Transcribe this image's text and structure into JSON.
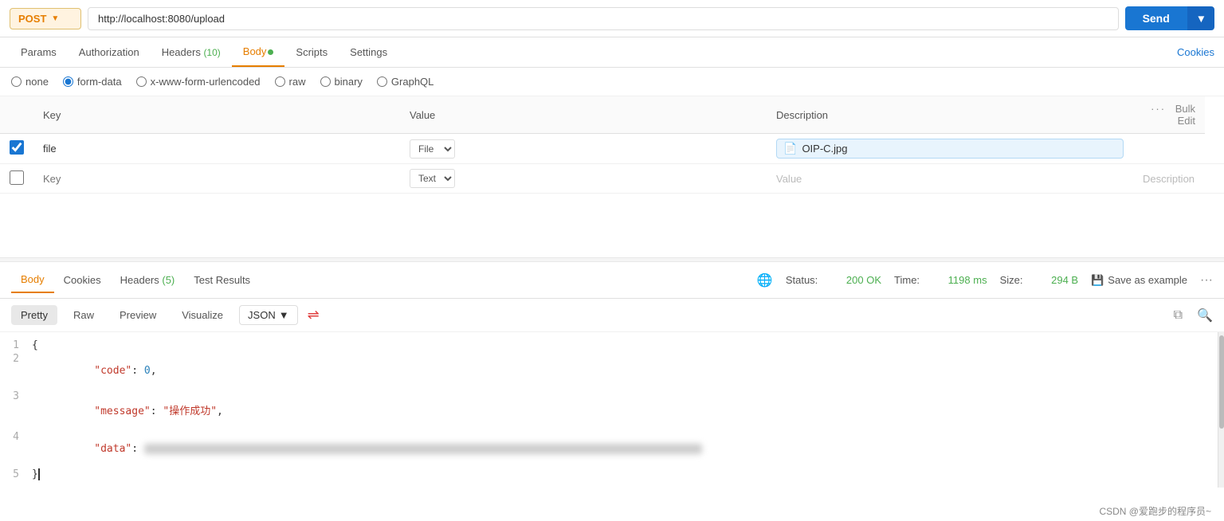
{
  "topbar": {
    "method": "POST",
    "url": "http://localhost:8080/upload",
    "send_label": "Send"
  },
  "request_tabs": [
    {
      "id": "params",
      "label": "Params",
      "badge": null,
      "dot": false,
      "active": false
    },
    {
      "id": "authorization",
      "label": "Authorization",
      "badge": null,
      "dot": false,
      "active": false
    },
    {
      "id": "headers",
      "label": "Headers",
      "badge": "(10)",
      "dot": false,
      "active": false
    },
    {
      "id": "body",
      "label": "Body",
      "badge": null,
      "dot": true,
      "active": true
    },
    {
      "id": "scripts",
      "label": "Scripts",
      "badge": null,
      "dot": false,
      "active": false
    },
    {
      "id": "settings",
      "label": "Settings",
      "badge": null,
      "dot": false,
      "active": false
    }
  ],
  "cookies_link": "Cookies",
  "body_options": [
    {
      "id": "none",
      "label": "none",
      "checked": false
    },
    {
      "id": "form-data",
      "label": "form-data",
      "checked": true
    },
    {
      "id": "x-www-form-urlencoded",
      "label": "x-www-form-urlencoded",
      "checked": false
    },
    {
      "id": "raw",
      "label": "raw",
      "checked": false
    },
    {
      "id": "binary",
      "label": "binary",
      "checked": false
    },
    {
      "id": "graphql",
      "label": "GraphQL",
      "checked": false
    }
  ],
  "table_headers": {
    "key": "Key",
    "value": "Value",
    "description": "Description",
    "bulk_edit": "Bulk Edit"
  },
  "table_rows": [
    {
      "checked": true,
      "key": "file",
      "type": "File",
      "value": "OIP-C.jpg",
      "description": ""
    }
  ],
  "empty_row": {
    "key_placeholder": "Key",
    "type": "Text",
    "value_placeholder": "Value",
    "desc_placeholder": "Description"
  },
  "response_tabs": [
    {
      "id": "body",
      "label": "Body",
      "active": true
    },
    {
      "id": "cookies",
      "label": "Cookies",
      "active": false
    },
    {
      "id": "headers",
      "label": "Headers",
      "badge": "(5)",
      "active": false
    },
    {
      "id": "test_results",
      "label": "Test Results",
      "active": false
    }
  ],
  "response_meta": {
    "status_label": "Status:",
    "status_value": "200 OK",
    "time_label": "Time:",
    "time_value": "1198 ms",
    "size_label": "Size:",
    "size_value": "294 B",
    "save_example": "Save as example"
  },
  "format_tabs": [
    {
      "id": "pretty",
      "label": "Pretty",
      "active": true
    },
    {
      "id": "raw",
      "label": "Raw",
      "active": false
    },
    {
      "id": "preview",
      "label": "Preview",
      "active": false
    },
    {
      "id": "visualize",
      "label": "Visualize",
      "active": false
    }
  ],
  "json_format": "JSON",
  "json_lines": [
    {
      "num": 1,
      "content": "{"
    },
    {
      "num": 2,
      "content": "    \"code\": 0,"
    },
    {
      "num": 3,
      "content": "    \"message\": \"操作成功\","
    },
    {
      "num": 4,
      "content": "    \"data\": [BLURRED]"
    },
    {
      "num": 5,
      "content": "}"
    }
  ],
  "watermark": "CSDN @爱跑步的程序员~"
}
